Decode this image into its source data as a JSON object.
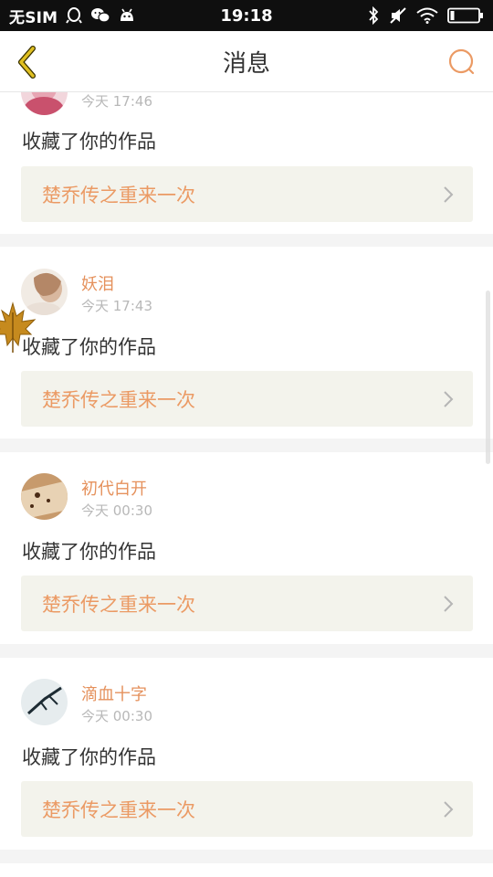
{
  "status_bar": {
    "carrier": "无SIM",
    "time": "19:18",
    "icons": [
      "qq-icon",
      "wechat-icon",
      "android-icon",
      "bluetooth-icon",
      "mute-icon",
      "wifi-icon",
      "battery-icon"
    ]
  },
  "header": {
    "title": "消息",
    "back_icon": "chevron-left-icon",
    "search_icon": "search-icon"
  },
  "messages": [
    {
      "username": "",
      "time": "今天 17:46",
      "action": "收藏了你的作品",
      "work_title": "楚乔传之重来一次"
    },
    {
      "username": "妖泪",
      "time": "今天 17:43",
      "action": "收藏了你的作品",
      "work_title": "楚乔传之重来一次"
    },
    {
      "username": "初代白开",
      "time": "今天 00:30",
      "action": "收藏了你的作品",
      "work_title": "楚乔传之重来一次"
    },
    {
      "username": "滴血十字",
      "time": "今天 00:30",
      "action": "收藏了你的作品",
      "work_title": "楚乔传之重来一次"
    }
  ],
  "colors": {
    "accent": "#eb9a64",
    "username": "#e5915c",
    "link_bg": "#f3f3ec",
    "back_icon": "#d8b41e"
  }
}
